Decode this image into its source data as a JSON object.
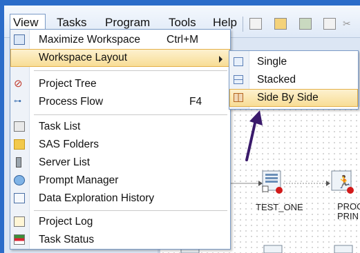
{
  "menubar": {
    "items": [
      {
        "label": "View"
      },
      {
        "label": "Tasks"
      },
      {
        "label": "Program"
      },
      {
        "label": "Tools"
      },
      {
        "label": "Help"
      }
    ]
  },
  "view_menu": {
    "items": [
      {
        "label": "Maximize Workspace",
        "shortcut": "Ctrl+M",
        "icon": "maximize-icon"
      },
      {
        "label": "Workspace Layout",
        "icon": "",
        "submenu": true
      },
      {
        "label": "Project Tree",
        "icon": "project-tree-icon"
      },
      {
        "label": "Process Flow",
        "shortcut": "F4",
        "icon": "process-flow-icon"
      },
      {
        "label": "Task List",
        "icon": "task-list-icon"
      },
      {
        "label": "SAS Folders",
        "icon": "sas-folders-icon"
      },
      {
        "label": "Server List",
        "icon": "server-list-icon"
      },
      {
        "label": "Prompt Manager",
        "icon": "prompt-manager-icon"
      },
      {
        "label": "Data Exploration History",
        "icon": "data-exploration-icon"
      },
      {
        "label": "Project Log",
        "icon": "project-log-icon"
      },
      {
        "label": "Task Status",
        "icon": "task-status-icon"
      }
    ]
  },
  "layout_submenu": {
    "items": [
      {
        "label": "Single"
      },
      {
        "label": "Stacked"
      },
      {
        "label": "Side By Side"
      }
    ]
  },
  "flow": {
    "nodes": [
      {
        "label": "TEST_ONE"
      },
      {
        "label": "PROC PRIN"
      }
    ]
  },
  "colors": {
    "highlight": "#f8dd95",
    "highlight_border": "#e3b04a",
    "menu_border": "#7b9bc6",
    "annotation_arrow": "#3a1a6b"
  }
}
